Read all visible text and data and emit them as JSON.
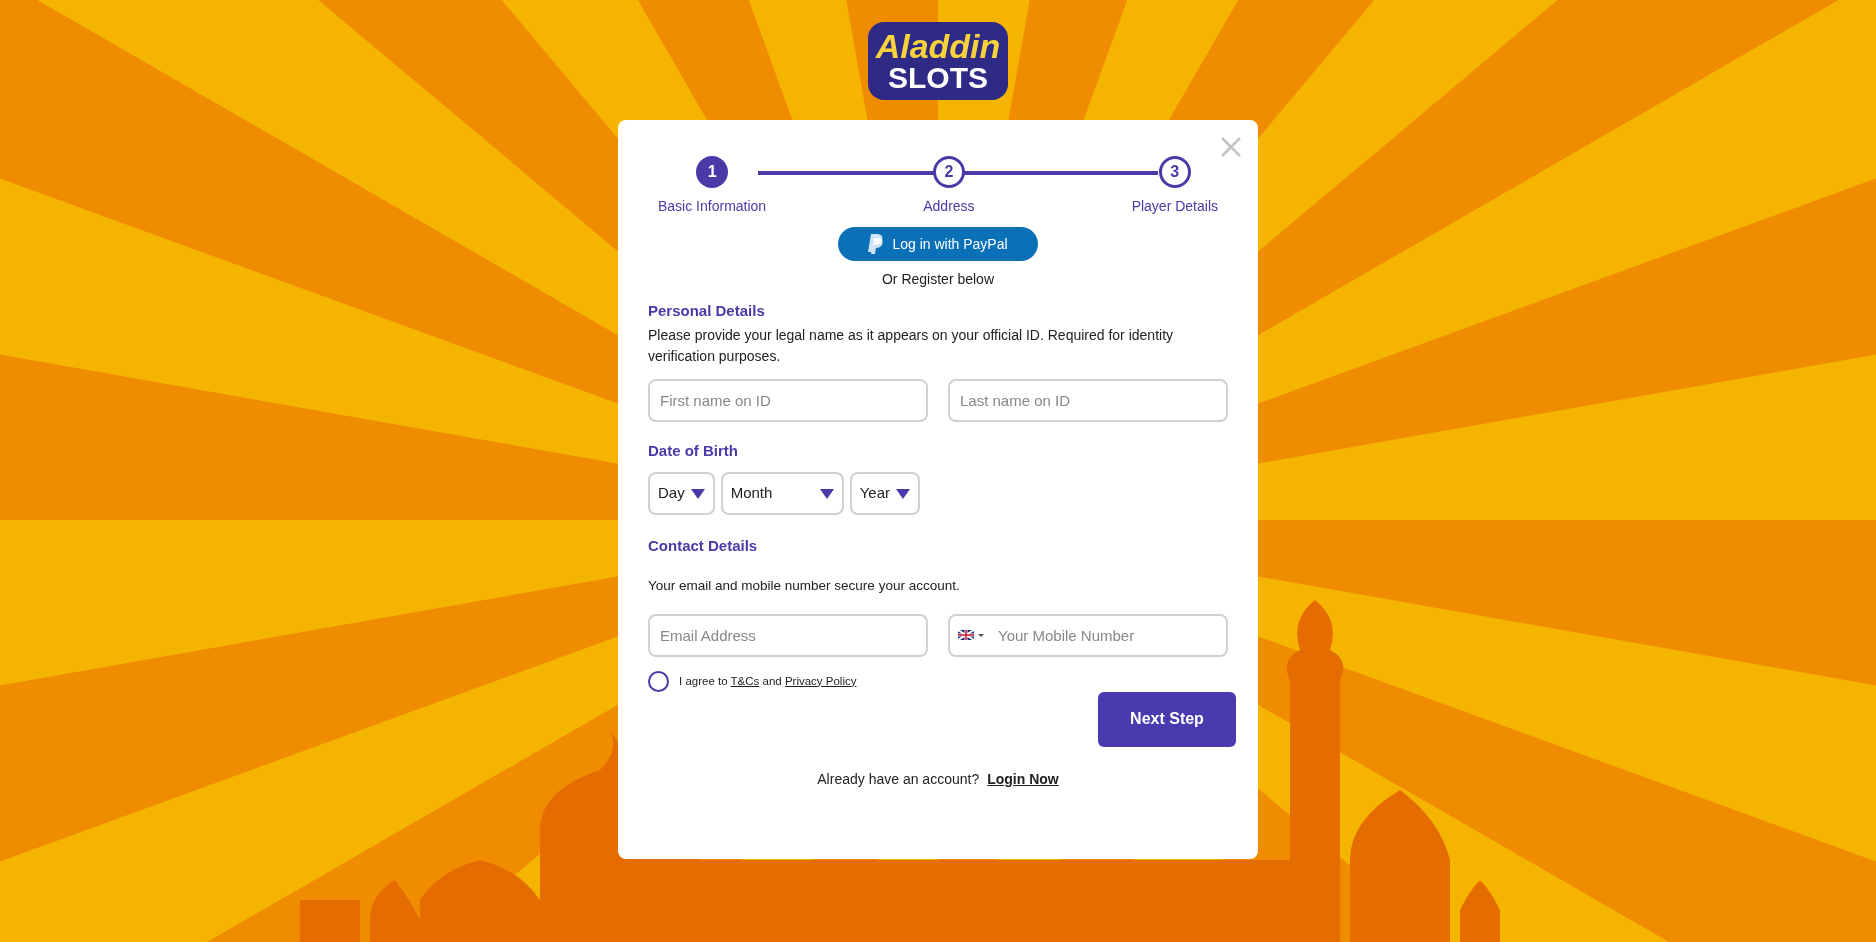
{
  "logo": {
    "line1": "Aladdin",
    "line2": "SLOTS"
  },
  "steps": [
    {
      "number": "1",
      "label": "Basic Information",
      "selected": true
    },
    {
      "number": "2",
      "label": "Address",
      "selected": false
    },
    {
      "number": "3",
      "label": "Player Details",
      "selected": false
    }
  ],
  "paypal_button": {
    "label": "Log in with PayPal"
  },
  "register_note": "Or Register below",
  "personal": {
    "heading": "Personal Details",
    "text": "Please provide your legal name as it appears on your official ID. Required for identity verification purposes.",
    "fields": [
      {
        "placeholder": "First name on ID"
      },
      {
        "placeholder": "Last name on ID"
      }
    ]
  },
  "birth": {
    "heading": "Date of Birth",
    "selects": [
      {
        "value": "Day"
      },
      {
        "value": "Month"
      },
      {
        "value": "Year"
      }
    ]
  },
  "contact": {
    "heading": "Contact Details",
    "text": "Your email and mobile number secure your account.",
    "email": {
      "placeholder": "Email Address"
    },
    "mobile": {
      "placeholder": "Your Mobile Number"
    }
  },
  "agreement": {
    "checked": false,
    "parts": [
      {
        "kind": "text",
        "text": "I agree to "
      },
      {
        "kind": "link",
        "text": "T&Cs"
      },
      {
        "kind": "text",
        "text": " and "
      },
      {
        "kind": "link",
        "text": "Privacy Policy"
      }
    ]
  },
  "next_button": "Next Step",
  "login": {
    "text": "Already have an account?",
    "link": "Login Now"
  }
}
